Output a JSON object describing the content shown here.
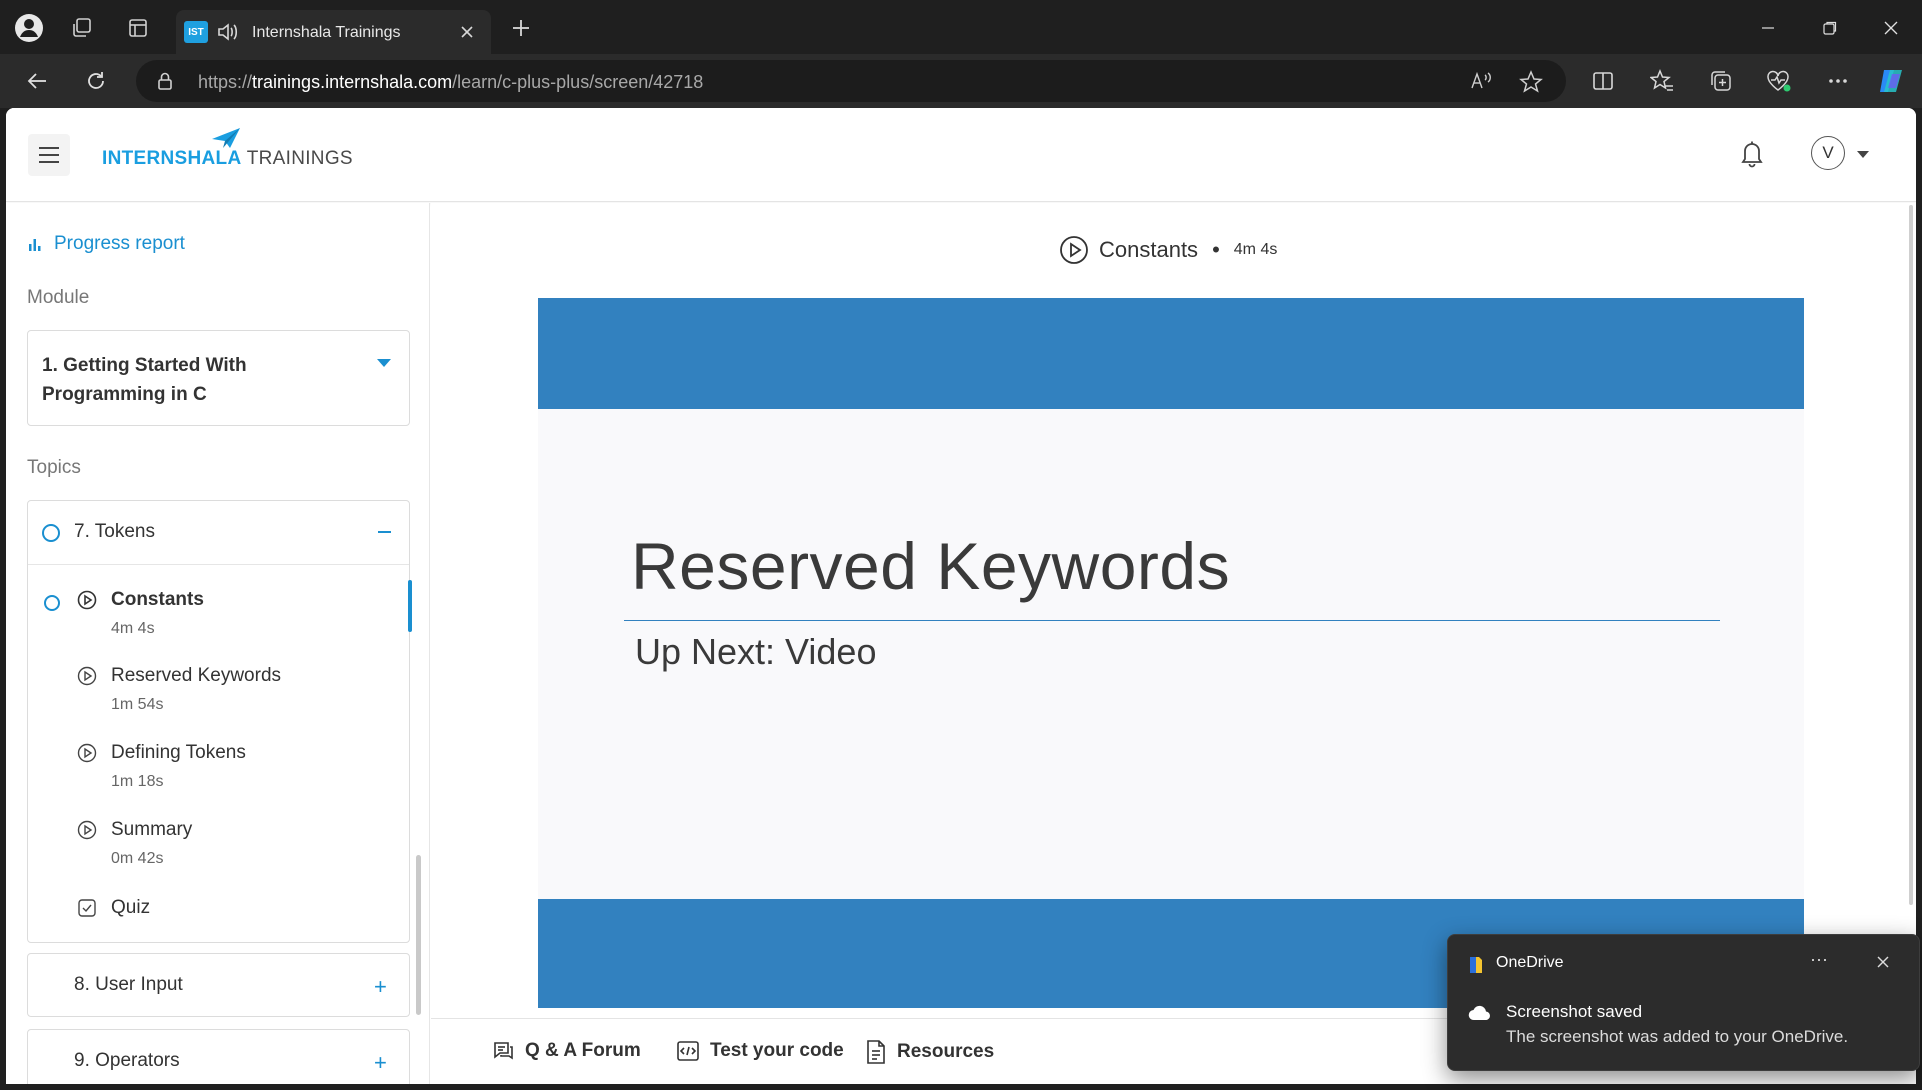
{
  "browser": {
    "tab_title": "Internshala Trainings",
    "tab_favicon_text": "IST",
    "url_prefix": "https://",
    "url_domain": "trainings.internshala.com",
    "url_path": "/learn/c-plus-plus/screen/42718"
  },
  "header": {
    "logo_brand": "INTERNSHALA",
    "logo_sub": "TRAININGS",
    "avatar_initial": "V"
  },
  "sidebar": {
    "progress_label": "Progress report",
    "module_label": "Module",
    "module_title": "1. Getting Started With Programming in C",
    "topics_label": "Topics",
    "current_topic": "7. Tokens",
    "lessons": [
      {
        "name": "Constants",
        "duration": "4m 4s",
        "type": "video",
        "active": true
      },
      {
        "name": "Reserved Keywords",
        "duration": "1m 54s",
        "type": "video",
        "active": false
      },
      {
        "name": "Defining Tokens",
        "duration": "1m 18s",
        "type": "video",
        "active": false
      },
      {
        "name": "Summary",
        "duration": "0m 42s",
        "type": "video",
        "active": false
      },
      {
        "name": "Quiz",
        "duration": "",
        "type": "quiz",
        "active": false
      }
    ],
    "other_topics": [
      "8. User Input",
      "9. Operators"
    ]
  },
  "main": {
    "video_title": "Constants",
    "video_separator": "•",
    "video_duration": "4m 4s",
    "slide_title": "Reserved Keywords",
    "slide_subtitle": "Up Next: Video"
  },
  "bottom_bar": {
    "forum": "Q & A Forum",
    "test_code": "Test your code",
    "resources": "Resources"
  },
  "toast": {
    "app": "OneDrive",
    "more": "···",
    "title": "Screenshot saved",
    "body": "The screenshot was added to your OneDrive."
  },
  "colors": {
    "accent": "#1a8fd0",
    "slide_band": "#3281bf",
    "browser_bg": "#1f1f1f"
  }
}
